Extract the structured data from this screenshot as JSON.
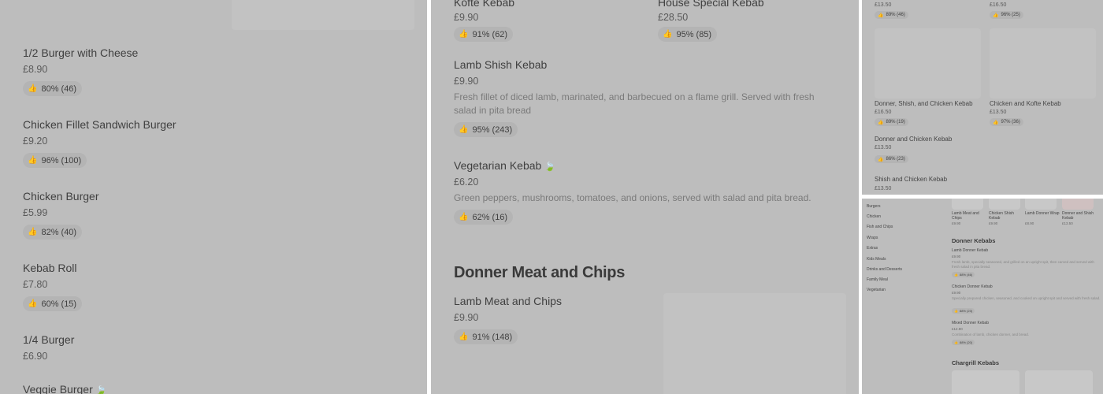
{
  "panel1": {
    "items": [
      {
        "name": "1/2 Burger with Cheese",
        "price": "£8.90",
        "rating": "80% (46)"
      },
      {
        "name": "Chicken Fillet Sandwich Burger",
        "price": "£9.20",
        "rating": "96% (100)"
      },
      {
        "name": "Chicken Burger",
        "price": "£5.99",
        "rating": "82% (40)"
      },
      {
        "name": "Kebab Roll",
        "price": "£7.80",
        "rating": "60% (15)"
      },
      {
        "name": "1/4 Burger",
        "price": "£6.90"
      },
      {
        "name": "Veggie Burger"
      }
    ]
  },
  "panel2": {
    "top_items": [
      {
        "name": "Kofte Kebab",
        "price": "£9.90",
        "rating": "91% (62)"
      },
      {
        "name": "House Special Kebab",
        "price": "£28.50",
        "rating": "95% (85)"
      }
    ],
    "items": [
      {
        "name": "Lamb Shish Kebab",
        "price": "£9.90",
        "description": "Fresh fillet of diced lamb, marinated, and barbecued on a flame grill. Served with fresh salad in pita bread",
        "rating": "95% (243)"
      },
      {
        "name": "Vegetarian Kebab",
        "price": "£6.20",
        "description": "Green peppers, mushrooms, tomatoes, and onions, served with salad and pita bread.",
        "rating": "62% (16)"
      }
    ],
    "section_title": "Donner Meat and Chips",
    "section_item": {
      "name": "Lamb Meat and Chips",
      "price": "£9.90",
      "rating": "91% (148)"
    }
  },
  "panel3": {
    "top": [
      {
        "price": "£13.50",
        "rating": "89% (46)"
      },
      {
        "price": "£16.50",
        "rating": "96% (25)"
      }
    ],
    "cards": [
      {
        "name": "Donner, Shish, and Chicken Kebab",
        "price": "£16.50",
        "rating": "89% (19)"
      },
      {
        "name": "Chicken and Kofte Kebab",
        "price": "£13.50",
        "rating": "97% (36)"
      }
    ],
    "list": [
      {
        "name": "Donner and Chicken Kebab",
        "price": "£13.50",
        "rating": "86% (23)"
      },
      {
        "name": "Shish and Chicken Kebab",
        "price": "£13.50"
      }
    ]
  },
  "panel4": {
    "categories": [
      "Burgers",
      "Chicken",
      "Fish and Chips",
      "Wraps",
      "Extras",
      "Kids Meals",
      "Drinks and Desserts",
      "Family Meal",
      "Vegetarian"
    ],
    "carousel": [
      {
        "name": "Lamb Meat and Chips",
        "price": "£9.90"
      },
      {
        "name": "Chicken Shish Kebab",
        "price": "£9.90"
      },
      {
        "name": "Lamb Donner Wrap",
        "price": "£8.90"
      },
      {
        "name": "Donner and Shish Kebab",
        "price": "£13.50"
      }
    ],
    "section1": "Donner Kebabs",
    "items": [
      {
        "name": "Lamb Donner Kebab",
        "price": "£9.90",
        "description": "Fresh lamb, specially seasoned, and grilled on an upright spit, then carved and served with fresh salad in pita bread.",
        "rating": "88% (46)"
      },
      {
        "name": "Chicken Donner Kebab",
        "price": "£9.90",
        "description": "Specially prepared chicken, seasoned, and cooked on upright spit and served with fresh salad.",
        "rating": "88% (23)"
      },
      {
        "name": "Mixed Donner Kebab",
        "price": "£12.90",
        "description": "Combination of lamb, chicken donner, and bread.",
        "rating": "88% (20)"
      }
    ],
    "section2": "Chargrill Kebabs"
  },
  "icons": {
    "thumb": "thumbs-up-icon",
    "leaf": "leaf-icon"
  }
}
